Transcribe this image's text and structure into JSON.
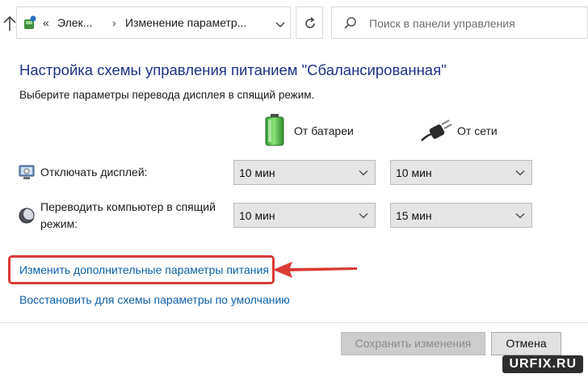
{
  "address_bar": {
    "breadcrumb_root": "Элек...",
    "breadcrumb_current": "Изменение параметр...",
    "search_placeholder": "Поиск в панели управления"
  },
  "main": {
    "title": "Настройка схемы управления питанием \"Сбалансированная\"",
    "subtitle": "Выберите параметры перевода дисплея в спящий режим.",
    "columns": {
      "battery": "От батареи",
      "ac": "От сети"
    },
    "rows": {
      "display": {
        "label": "Отключать дисплей:",
        "battery_value": "10 мин",
        "ac_value": "10 мин"
      },
      "sleep": {
        "label_line1": "Переводить компьютер в спящий",
        "label_line2": "режим:",
        "battery_value": "10 мин",
        "ac_value": "15 мин"
      }
    },
    "links": {
      "advanced": "Изменить дополнительные параметры питания",
      "restore": "Восстановить для схемы параметры по умолчанию"
    }
  },
  "footer": {
    "save_label": "Сохранить изменения",
    "cancel_label": "Отмена",
    "save_enabled": false
  },
  "watermark": "URFIX.RU",
  "colors": {
    "title": "#1e3287",
    "link": "#0b5fa8",
    "highlight": "#d83b33"
  }
}
